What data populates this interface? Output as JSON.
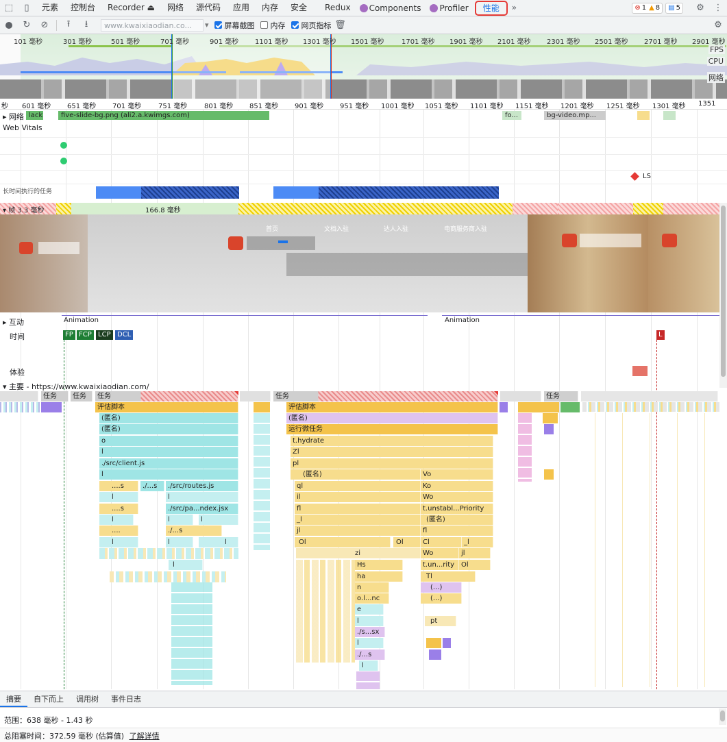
{
  "tabs": [
    {
      "id": "elements",
      "label": "元素"
    },
    {
      "id": "console",
      "label": "控制台"
    },
    {
      "id": "recorder",
      "label": "Recorder ⏏"
    },
    {
      "id": "network",
      "label": "网络"
    },
    {
      "id": "sources",
      "label": "源代码"
    },
    {
      "id": "application",
      "label": "应用"
    },
    {
      "id": "memory",
      "label": "内存"
    },
    {
      "id": "security",
      "label": "安全"
    },
    {
      "id": "redux",
      "label": "Redux"
    },
    {
      "id": "components",
      "label": "Components"
    },
    {
      "id": "profiler",
      "label": "Profiler"
    },
    {
      "id": "performance",
      "label": "性能"
    }
  ],
  "more": "»",
  "badges": {
    "errors": "1",
    "warnings": "8",
    "messages": "5"
  },
  "toolbar": {
    "url": "www.kwaixiaodian.co...",
    "screenshots": "屏幕截图",
    "memory": "内存",
    "webvitals": "网页指标"
  },
  "overview": {
    "ticks": [
      "101 毫秒",
      "301 毫秒",
      "501 毫秒",
      "701 毫秒",
      "901 毫秒",
      "1101 毫秒",
      "1301 毫秒",
      "1501 毫秒",
      "1701 毫秒",
      "1901 毫秒",
      "2101 毫秒",
      "2301 毫秒",
      "2501 毫秒",
      "2701 毫秒",
      "2901 毫秒"
    ],
    "lanes": {
      "fps": "FPS",
      "cpu": "CPU",
      "net": "网络"
    }
  },
  "ruler": [
    "秒",
    "601 毫秒",
    "651 毫秒",
    "701 毫秒",
    "751 毫秒",
    "801 毫秒",
    "851 毫秒",
    "901 毫秒",
    "951 毫秒",
    "1001 毫秒",
    "1051 毫秒",
    "1101 毫秒",
    "1151 毫秒",
    "1201 毫秒",
    "1251 毫秒",
    "1301 毫秒",
    "1351"
  ],
  "tracks": {
    "network": "网络",
    "network_items": [
      "lack",
      "five-slide-bg.png (ali2.a.kwimgs.com)",
      "fo...",
      "bg-video.mp..."
    ],
    "web_vitals": "Web Vitals",
    "ls": "LS",
    "long_tasks": "长时间执行的任务",
    "frames": "帧",
    "frames_first": "3.3 毫秒",
    "frames_duration": "166.8 毫秒",
    "interactions": "互动",
    "animation_1": "Animation",
    "animation_2": "Animation",
    "timings": "时间",
    "markers": [
      "FP",
      "FCP",
      "LCP",
      "DCL"
    ],
    "marker_l": "L",
    "experience": "体验",
    "main": "主要 - https://www.kwaixiaodian.com/"
  },
  "flame": {
    "tasks": [
      "任务",
      "任务",
      "任务",
      "任务",
      "任务"
    ],
    "left": [
      "评估脚本",
      "(匿名)",
      "(匿名)",
      "o",
      "l",
      "./src/client.js",
      "l",
      "....s",
      "./...s",
      "./src/routes.js",
      "l",
      "l",
      "....s",
      "./src/pa...ndex.jsx",
      "l",
      "l",
      "l",
      "....",
      "./...s",
      "l",
      "l",
      "l",
      "l"
    ],
    "right": [
      "评估脚本",
      "(匿名)",
      "运行微任务",
      "t.hydrate",
      "Zl",
      "pl",
      "(匿名)",
      "Vo",
      "ql",
      "Ko",
      "il",
      "Wo",
      "fl",
      "t.unstabl...Priority",
      "_l",
      "(匿名)",
      "jl",
      "fl",
      "Ol",
      "Ol",
      "Cl",
      "_l",
      "zi",
      "Wo",
      "jl",
      "Hs",
      "t.un...rity",
      "Ol",
      "ha",
      "Tl",
      "n",
      "(...)",
      "o.l...nc",
      "(...)",
      "e",
      "l",
      "pt",
      "./s...sx",
      "l",
      "./...s",
      "l"
    ]
  },
  "shots": {
    "nav": [
      "首页",
      "文档入驻",
      "达人入驻",
      "电商服务商入驻"
    ]
  },
  "bottom_tabs": [
    "摘要",
    "自下而上",
    "调用树",
    "事件日志"
  ],
  "summary": {
    "range": "范围：638 毫秒 - 1.43 秒",
    "blocking": "总阻塞时间：372.59 毫秒 (估算值)",
    "learn_more": "了解详情"
  },
  "colors": {
    "accent": "#1a73e8",
    "highlight": "#e53935",
    "script": "#f4c34b",
    "net_green": "#66bb6a"
  }
}
